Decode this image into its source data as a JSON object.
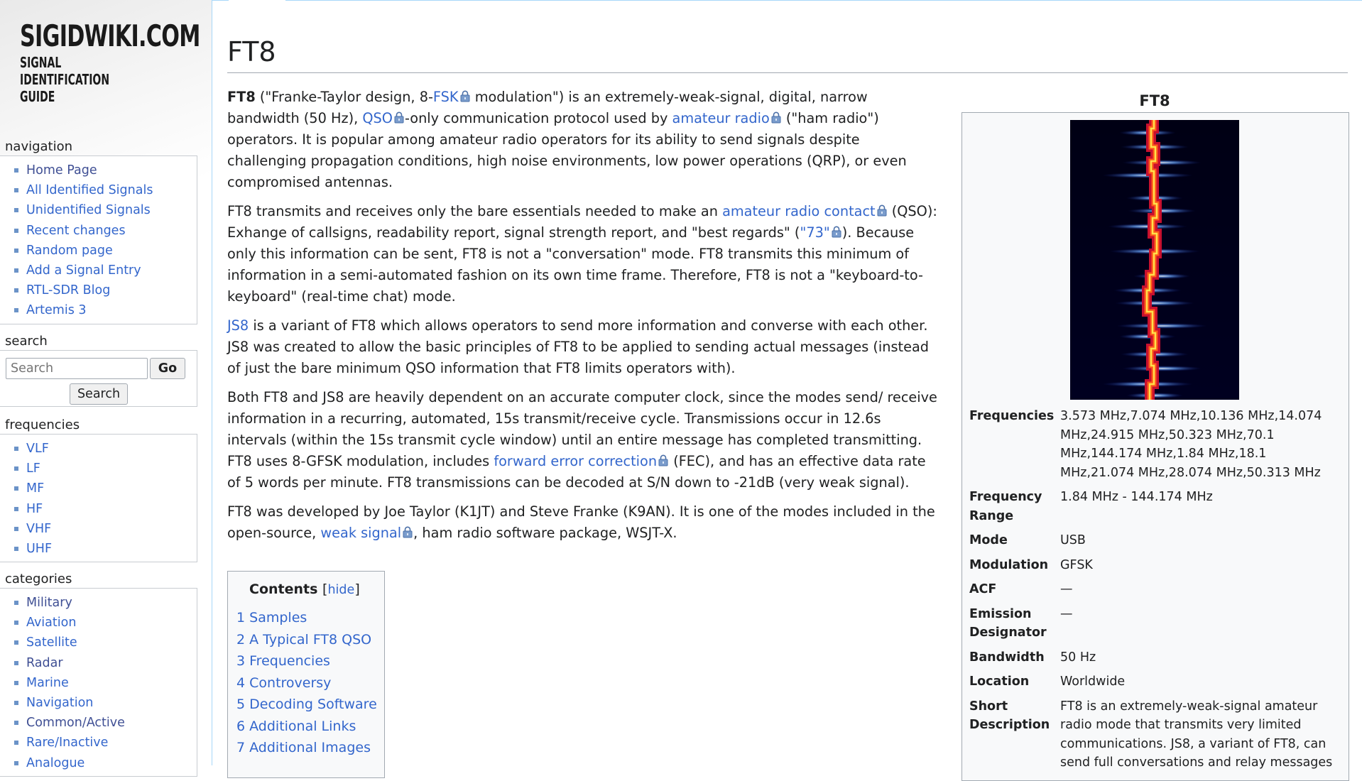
{
  "site": {
    "logo_line1": "SIGIDWIKI.COM",
    "logo_line2": "SIGNAL IDENTIFICATION GUIDE"
  },
  "sidebar": {
    "navigation": {
      "title": "navigation",
      "items": [
        "Home Page",
        "All Identified Signals",
        "Unidentified Signals",
        "Recent changes",
        "Random page",
        "Add a Signal Entry",
        "RTL-SDR Blog",
        "Artemis 3"
      ]
    },
    "search": {
      "title": "search",
      "placeholder": "Search",
      "go_label": "Go",
      "search_label": "Search"
    },
    "frequencies": {
      "title": "frequencies",
      "items": [
        "VLF",
        "LF",
        "MF",
        "HF",
        "VHF",
        "UHF"
      ]
    },
    "categories": {
      "title": "categories",
      "items": [
        "Military",
        "Aviation",
        "Satellite",
        "Radar",
        "Marine",
        "Navigation",
        "Common/Active",
        "Rare/Inactive",
        "Analogue"
      ]
    }
  },
  "page": {
    "title": "FT8",
    "p1": {
      "bold": "FT8",
      "t1": " (\"Franke-Taylor design, 8-",
      "link_fsk": "FSK",
      "t2": " modulation\") is an extremely-weak-signal, digital, narrow bandwidth (50 Hz), ",
      "link_qso": "QSO",
      "t3": "-only communication protocol used by ",
      "link_amateur": "amateur radio",
      "t4": " (\"ham radio\") operators. It is popular among amateur radio operators for its ability to send signals despite challenging propagation conditions, high noise environments, low power operations (QRP), or even compromised antennas."
    },
    "p2": {
      "t1": "FT8 transmits and receives only the bare essentials needed to make an ",
      "link_contact": "amateur radio contact",
      "t2": " (QSO): Exhange of callsigns, readability report, signal strength report, and \"best regards\" (",
      "link_73": "\"73\"",
      "t3": "). Because only this information can be sent, FT8 is not a \"conversation\" mode. FT8 transmits this minimum of information in a semi-automated fashion on its own time frame. Therefore, FT8 is not a \"keyboard-to-keyboard\" (real-time chat) mode."
    },
    "p3": {
      "link_js8": "JS8",
      "t1": " is a variant of FT8 which allows operators to send more information and converse with each other. JS8 was created to allow the basic principles of FT8 to be applied to sending actual messages (instead of just the bare minimum QSO information that FT8 limits operators with)."
    },
    "p4": {
      "t1": "Both FT8 and JS8 are heavily dependent on an accurate computer clock, since the modes send/ receive information in a recurring, automated, 15s transmit/receive cycle. Transmissions occur in 12.6s intervals (within the 15s transmit cycle window) until an entire message has completed transmitting. FT8 uses 8-GFSK modulation, includes ",
      "link_fec": "forward error correction",
      "t2": " (FEC), and has an effective data rate of 5 words per minute. FT8 transmissions can be decoded at S/N down to -21dB (very weak signal)."
    },
    "p5": {
      "t1": "FT8 was developed by Joe Taylor (K1JT) and Steve Franke (K9AN). It is one of the modes included in the open-source, ",
      "link_weak": "weak signal",
      "t2": ", ham radio software package, WSJT-X."
    }
  },
  "toc": {
    "title": "Contents",
    "hide_label": "hide",
    "items": [
      {
        "num": "1",
        "label": "Samples"
      },
      {
        "num": "2",
        "label": "A Typical FT8 QSO"
      },
      {
        "num": "3",
        "label": "Frequencies"
      },
      {
        "num": "4",
        "label": "Controversy"
      },
      {
        "num": "5",
        "label": "Decoding Software"
      },
      {
        "num": "6",
        "label": "Additional Links"
      },
      {
        "num": "7",
        "label": "Additional Images"
      }
    ]
  },
  "infobox": {
    "title": "FT8",
    "rows": [
      {
        "key": "Frequencies",
        "value": "3.573 MHz,7.074 MHz,10.136 MHz,14.074 MHz,24.915 MHz,50.323 MHz,70.1 MHz,144.174 MHz,1.84 MHz,18.1 MHz,21.074 MHz,28.074 MHz,50.313 MHz"
      },
      {
        "key": "Frequency Range",
        "value": "1.84 MHz - 144.174 MHz"
      },
      {
        "key": "Mode",
        "value": "USB"
      },
      {
        "key": "Modulation",
        "value": "GFSK"
      },
      {
        "key": "ACF",
        "value": "—"
      },
      {
        "key": "Emission Designator",
        "value": "—"
      },
      {
        "key": "Bandwidth",
        "value": "50 Hz"
      },
      {
        "key": "Location",
        "value": "Worldwide"
      },
      {
        "key": "Short Description",
        "value": "FT8 is an extremely-weak-signal amateur radio mode that transmits very limited communications. JS8, a variant of FT8, can send full conversations and relay messages"
      }
    ]
  },
  "colors": {
    "link": "#3366cc",
    "visited_link": "#3f4f94",
    "waterfall_bg": "#00001a",
    "waterfall_trace": "#e8281a",
    "waterfall_core": "#ffd23a"
  },
  "icons": {
    "external_lock": "lock-icon",
    "sidebar_bullet": "square-bullet-icon"
  }
}
